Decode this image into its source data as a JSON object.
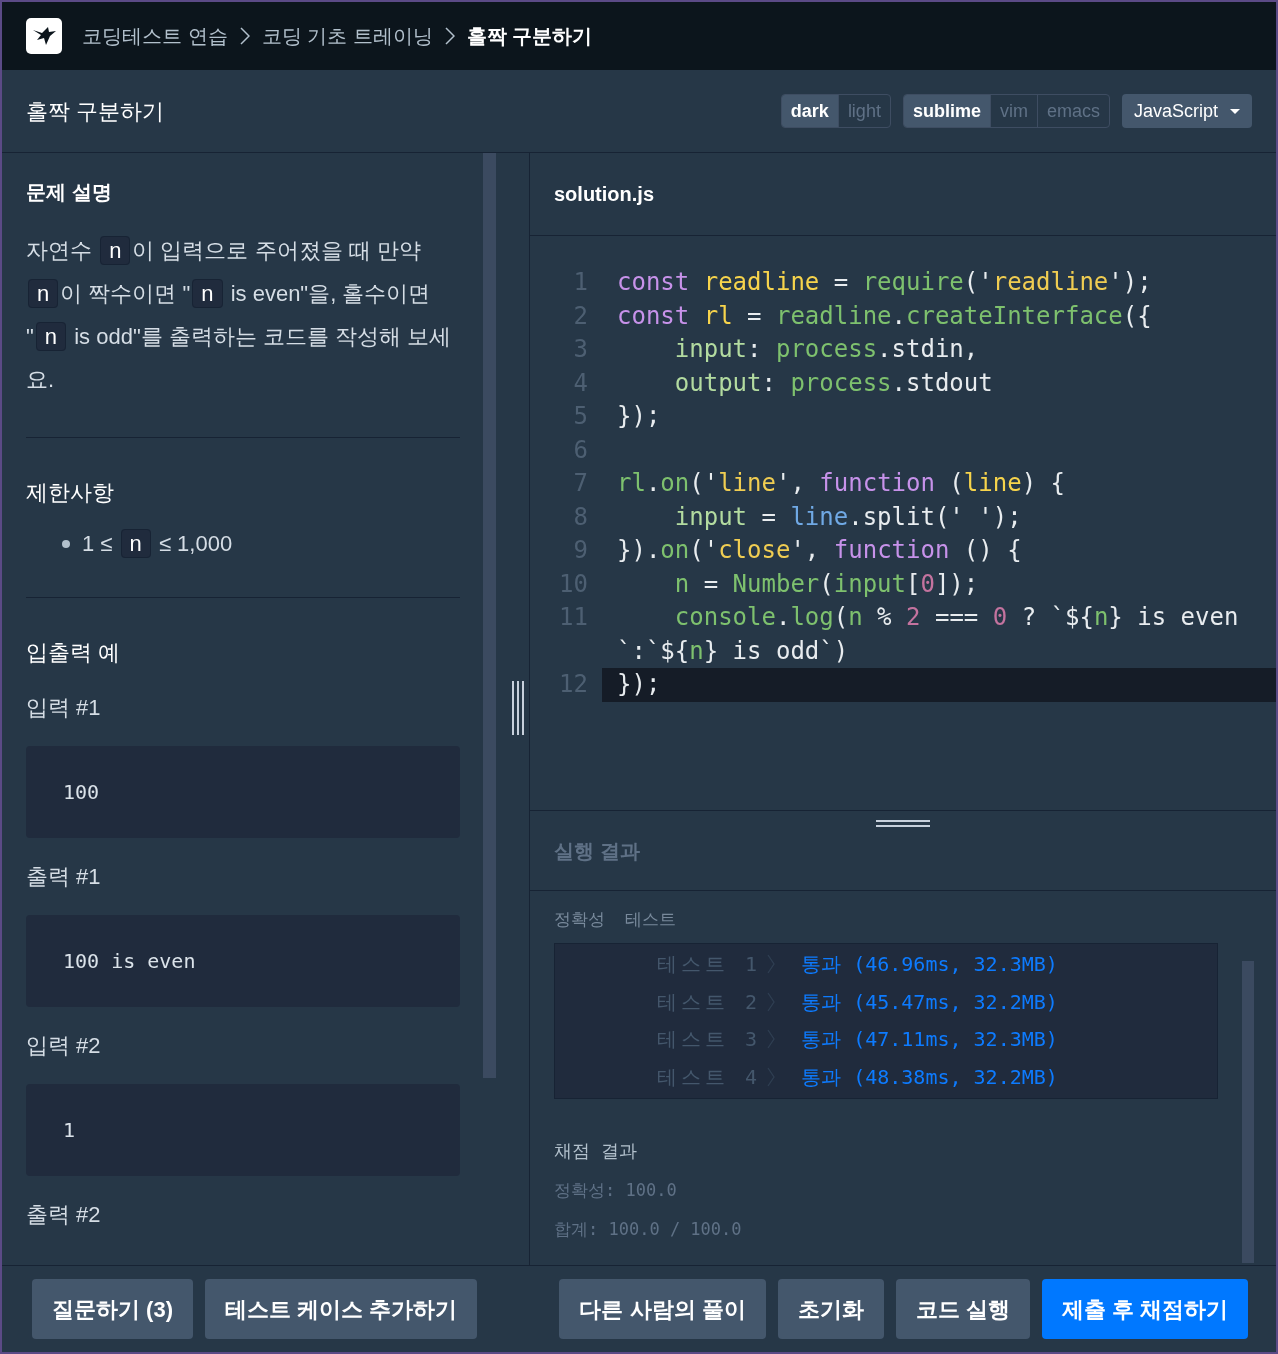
{
  "breadcrumb": [
    {
      "label": "코딩테스트 연습",
      "current": false
    },
    {
      "label": "코딩 기초 트레이닝",
      "current": false
    },
    {
      "label": "홀짝 구분하기",
      "current": true
    }
  ],
  "title": "홀짝 구분하기",
  "theme_toggle": [
    {
      "label": "dark",
      "selected": true
    },
    {
      "label": "light",
      "selected": false
    }
  ],
  "keymap_toggle": [
    {
      "label": "sublime",
      "selected": true
    },
    {
      "label": "vim",
      "selected": false
    },
    {
      "label": "emacs",
      "selected": false
    }
  ],
  "language": "JavaScript",
  "problem": {
    "heading": "문제 설명",
    "description": [
      {
        "kind": "text",
        "text": "자연수 "
      },
      {
        "kind": "code",
        "text": "n"
      },
      {
        "kind": "text",
        "text": "이 입력으로 주어졌을 때 만약 "
      },
      {
        "kind": "code",
        "text": "n"
      },
      {
        "kind": "text",
        "text": "이 짝수이면 \""
      },
      {
        "kind": "code",
        "text": "n"
      },
      {
        "kind": "text",
        "text": " is even\"을, 홀수이면 \""
      },
      {
        "kind": "code",
        "text": "n"
      },
      {
        "kind": "text",
        "text": " is odd\"를 출력하는 코드를 작성해 보세요."
      }
    ],
    "constraints_heading": "제한사항",
    "constraints": [
      [
        {
          "kind": "text",
          "text": "1 ≤ "
        },
        {
          "kind": "code",
          "text": "n"
        },
        {
          "kind": "text",
          "text": " ≤ 1,000"
        }
      ]
    ],
    "examples_heading": "입출력 예",
    "examples": [
      {
        "label": "입력 #1",
        "value": "100"
      },
      {
        "label": "출력 #1",
        "value": "100 is even"
      },
      {
        "label": "입력 #2",
        "value": "1"
      },
      {
        "label": "출력 #2"
      }
    ]
  },
  "editor": {
    "filename": "solution.js",
    "lines": [
      {
        "number": "1",
        "active": false,
        "tokens": [
          {
            "kind": "keyword",
            "text": "const "
          },
          {
            "kind": "def",
            "text": "readline"
          },
          {
            "kind": "plain",
            "text": " = "
          },
          {
            "kind": "builtin",
            "text": "require"
          },
          {
            "kind": "plain",
            "text": "('"
          },
          {
            "kind": "string",
            "text": "readline"
          },
          {
            "kind": "plain",
            "text": "');"
          }
        ]
      },
      {
        "number": "2",
        "active": false,
        "tokens": [
          {
            "kind": "keyword",
            "text": "const "
          },
          {
            "kind": "def",
            "text": "rl"
          },
          {
            "kind": "plain",
            "text": " = "
          },
          {
            "kind": "builtin",
            "text": "readline"
          },
          {
            "kind": "plain",
            "text": "."
          },
          {
            "kind": "builtin",
            "text": "createInterface"
          },
          {
            "kind": "plain",
            "text": "({"
          }
        ]
      },
      {
        "number": "3",
        "active": false,
        "tokens": [
          {
            "kind": "property",
            "text": "    input"
          },
          {
            "kind": "plain",
            "text": ": "
          },
          {
            "kind": "builtin",
            "text": "process"
          },
          {
            "kind": "plain",
            "text": ".stdin,"
          }
        ]
      },
      {
        "number": "4",
        "active": false,
        "tokens": [
          {
            "kind": "property",
            "text": "    output"
          },
          {
            "kind": "plain",
            "text": ": "
          },
          {
            "kind": "builtin",
            "text": "process"
          },
          {
            "kind": "plain",
            "text": ".stdout"
          }
        ]
      },
      {
        "number": "5",
        "active": false,
        "tokens": [
          {
            "kind": "plain",
            "text": "});"
          }
        ]
      },
      {
        "number": "6",
        "active": false
      },
      {
        "number": "7",
        "active": false,
        "tokens": [
          {
            "kind": "builtin",
            "text": "rl"
          },
          {
            "kind": "plain",
            "text": "."
          },
          {
            "kind": "builtin",
            "text": "on"
          },
          {
            "kind": "plain",
            "text": "('"
          },
          {
            "kind": "string",
            "text": "line"
          },
          {
            "kind": "plain",
            "text": "', "
          },
          {
            "kind": "keyword",
            "text": "function"
          },
          {
            "kind": "plain",
            "text": " ("
          },
          {
            "kind": "def",
            "text": "line"
          },
          {
            "kind": "plain",
            "text": ") {"
          }
        ]
      },
      {
        "number": "8",
        "active": false,
        "tokens": [
          {
            "kind": "property",
            "text": "    input"
          },
          {
            "kind": "plain",
            "text": " = "
          },
          {
            "kind": "variable",
            "text": "line"
          },
          {
            "kind": "plain",
            "text": ".split(' ');"
          }
        ]
      },
      {
        "number": "9",
        "active": false,
        "tokens": [
          {
            "kind": "plain",
            "text": "})."
          },
          {
            "kind": "builtin",
            "text": "on"
          },
          {
            "kind": "plain",
            "text": "('"
          },
          {
            "kind": "string",
            "text": "close"
          },
          {
            "kind": "plain",
            "text": "', "
          },
          {
            "kind": "keyword",
            "text": "function"
          },
          {
            "kind": "plain",
            "text": " () {"
          }
        ]
      },
      {
        "number": "10",
        "active": false,
        "tokens": [
          {
            "kind": "builtin",
            "text": "    n"
          },
          {
            "kind": "plain",
            "text": " = "
          },
          {
            "kind": "builtin",
            "text": "Number"
          },
          {
            "kind": "plain",
            "text": "("
          },
          {
            "kind": "builtin",
            "text": "input"
          },
          {
            "kind": "plain",
            "text": "["
          },
          {
            "kind": "number",
            "text": "0"
          },
          {
            "kind": "plain",
            "text": "]);"
          }
        ]
      },
      {
        "number": "11",
        "active": false,
        "tokens": [
          {
            "kind": "builtin",
            "text": "    console"
          },
          {
            "kind": "plain",
            "text": "."
          },
          {
            "kind": "builtin",
            "text": "log"
          },
          {
            "kind": "plain",
            "text": "("
          },
          {
            "kind": "builtin",
            "text": "n"
          },
          {
            "kind": "plain",
            "text": " % "
          },
          {
            "kind": "number",
            "text": "2"
          },
          {
            "kind": "plain",
            "text": " === "
          },
          {
            "kind": "number",
            "text": "0"
          },
          {
            "kind": "plain",
            "text": " ? `${"
          },
          {
            "kind": "builtin",
            "text": "n"
          },
          {
            "kind": "plain",
            "text": "} is even `:`${"
          },
          {
            "kind": "builtin",
            "text": "n"
          },
          {
            "kind": "plain",
            "text": "} is odd`)"
          }
        ]
      },
      {
        "number": "12",
        "active": true,
        "tokens": [
          {
            "kind": "plain",
            "text": "});"
          }
        ]
      }
    ]
  },
  "results": {
    "heading": "실행 결과",
    "tab_label": "정확성  테스트",
    "tests": [
      {
        "label": "테스트 1",
        "result": "통과 (46.96ms, 32.3MB)"
      },
      {
        "label": "테스트 2",
        "result": "통과 (45.47ms, 32.2MB)"
      },
      {
        "label": "테스트 3",
        "result": "통과 (47.11ms, 32.3MB)"
      },
      {
        "label": "테스트 4",
        "result": "통과 (48.38ms, 32.2MB)"
      }
    ],
    "score_heading": "채점 결과",
    "score_lines": [
      "정확성: 100.0",
      "합계: 100.0 / 100.0"
    ]
  },
  "left_buttons": [
    {
      "label": "질문하기 (3)",
      "kind": "secondary"
    },
    {
      "label": "테스트 케이스 추가하기",
      "kind": "secondary"
    }
  ],
  "right_buttons": [
    {
      "label": "다른 사람의 풀이",
      "kind": "secondary"
    },
    {
      "label": "초기화",
      "kind": "secondary"
    },
    {
      "label": "코드 실행",
      "kind": "secondary"
    },
    {
      "label": "제출 후 채점하기",
      "kind": "primary"
    }
  ]
}
